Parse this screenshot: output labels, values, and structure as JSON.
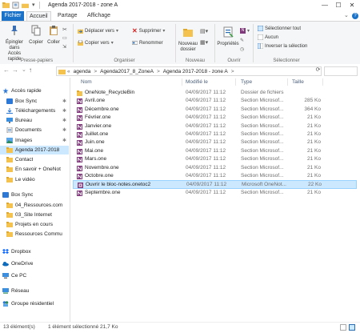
{
  "window": {
    "title": "Agenda 2017-2018 - zone A",
    "controls": {
      "minimize": "—",
      "maximize": "☐",
      "close": "✕"
    }
  },
  "tabs": {
    "file": "Fichier",
    "home": "Accueil",
    "share": "Partage",
    "view": "Affichage"
  },
  "ribbon": {
    "clipboard": {
      "pin": "Épingler dans Accès rapide",
      "copy": "Copier",
      "paste": "Coller",
      "label": "Presse-papiers"
    },
    "organize": {
      "move_to": "Déplacer vers",
      "copy_to": "Copier vers",
      "delete": "Supprimer",
      "rename": "Renommer",
      "label": "Organiser"
    },
    "new": {
      "new_folder": "Nouveau dossier",
      "label": "Nouveau"
    },
    "open": {
      "properties": "Propriétés",
      "label": "Ouvrir"
    },
    "select": {
      "select_all": "Sélectionner tout",
      "select_none": "Aucun",
      "invert": "Inverser la sélection",
      "label": "Sélectionner"
    }
  },
  "address": {
    "nav_back": "←",
    "nav_forward": "→",
    "nav_recent": "⌄",
    "nav_up": "↑",
    "crumbs": [
      "«",
      "agenda",
      ">",
      "Agenda2017_8_ZoneA",
      ">",
      "Agenda 2017-2018 - zone A",
      ">"
    ],
    "refresh": "⟳"
  },
  "sidebar": {
    "items": [
      {
        "label": "Accès rapide",
        "icon": "star-icon",
        "pinned": false
      },
      {
        "label": "Box Sync",
        "icon": "box-icon",
        "pinned": true
      },
      {
        "label": "Téléchargements",
        "icon": "download-icon",
        "pinned": true
      },
      {
        "label": "Bureau",
        "icon": "desktop-icon",
        "pinned": true
      },
      {
        "label": "Documents",
        "icon": "documents-icon",
        "pinned": true
      },
      {
        "label": "Images",
        "icon": "images-icon",
        "pinned": true
      },
      {
        "label": "Agenda 2017-2018",
        "icon": "folder-icon",
        "pinned": false
      },
      {
        "label": "Contact",
        "icon": "folder-icon",
        "pinned": false
      },
      {
        "label": "En savoir + OneNot",
        "icon": "folder-icon",
        "pinned": false
      },
      {
        "label": "Le vidéo",
        "icon": "folder-icon",
        "pinned": false
      },
      {
        "label": "Box Sync",
        "icon": "box-icon",
        "pinned": false
      },
      {
        "label": "04_Ressources.com",
        "icon": "folder-icon",
        "pinned": false
      },
      {
        "label": "03_Site Internet",
        "icon": "folder-icon",
        "pinned": false
      },
      {
        "label": "Projets en cours",
        "icon": "folder-icon",
        "pinned": false
      },
      {
        "label": "Ressources Commu",
        "icon": "folder-icon",
        "pinned": false
      },
      {
        "label": "Dropbox",
        "icon": "dropbox-icon",
        "pinned": false
      },
      {
        "label": "OneDrive",
        "icon": "onedrive-icon",
        "pinned": false
      },
      {
        "label": "Ce PC",
        "icon": "pc-icon",
        "pinned": false
      },
      {
        "label": "Réseau",
        "icon": "network-icon",
        "pinned": false
      },
      {
        "label": "Groupe résidentiel",
        "icon": "homegroup-icon",
        "pinned": false
      }
    ],
    "pin_glyph": "✱"
  },
  "columns": {
    "name": "Nom",
    "modified": "Modifié le",
    "type": "Type",
    "size": "Taille"
  },
  "files": [
    {
      "name": "OneNote_RecycleBin",
      "modified": "04/09/2017 11:12",
      "type": "Dossier de fichiers",
      "size": "",
      "kind": "folder"
    },
    {
      "name": "Avril.one",
      "modified": "04/09/2017 11:12",
      "type": "Section Microsof...",
      "size": "285 Ko",
      "kind": "one"
    },
    {
      "name": "Décembre.one",
      "modified": "04/09/2017 11:12",
      "type": "Section Microsof...",
      "size": "364 Ko",
      "kind": "one"
    },
    {
      "name": "Février.one",
      "modified": "04/09/2017 11:12",
      "type": "Section Microsof...",
      "size": "21 Ko",
      "kind": "one"
    },
    {
      "name": "Janvier.one",
      "modified": "04/09/2017 11:12",
      "type": "Section Microsof...",
      "size": "21 Ko",
      "kind": "one"
    },
    {
      "name": "Juillet.one",
      "modified": "04/09/2017 11:12",
      "type": "Section Microsof...",
      "size": "21 Ko",
      "kind": "one"
    },
    {
      "name": "Juin.one",
      "modified": "04/09/2017 11:12",
      "type": "Section Microsof...",
      "size": "21 Ko",
      "kind": "one"
    },
    {
      "name": "Mai.one",
      "modified": "04/09/2017 11:12",
      "type": "Section Microsof...",
      "size": "21 Ko",
      "kind": "one"
    },
    {
      "name": "Mars.one",
      "modified": "04/09/2017 11:12",
      "type": "Section Microsof...",
      "size": "21 Ko",
      "kind": "one"
    },
    {
      "name": "Novembre.one",
      "modified": "04/09/2017 11:12",
      "type": "Section Microsof...",
      "size": "21 Ko",
      "kind": "one"
    },
    {
      "name": "Octobre.one",
      "modified": "04/09/2017 11:12",
      "type": "Section Microsof...",
      "size": "21 Ko",
      "kind": "one"
    },
    {
      "name": "Ouvrir le bloc-notes.onetoc2",
      "modified": "04/09/2017 11:12",
      "type": "Microsoft OneNot...",
      "size": "22 Ko",
      "kind": "toc",
      "selected": true
    },
    {
      "name": "Septembre.one",
      "modified": "04/09/2017 11:12",
      "type": "Section Microsof...",
      "size": "21 Ko",
      "kind": "one"
    }
  ],
  "status": {
    "count": "13 élément(s)",
    "selection": "1 élément sélectionné 21,7 Ko"
  },
  "colors": {
    "accent": "#1a73c9",
    "selection": "#cce8ff",
    "folder": "#f3c24f",
    "onenote": "#80397b"
  }
}
